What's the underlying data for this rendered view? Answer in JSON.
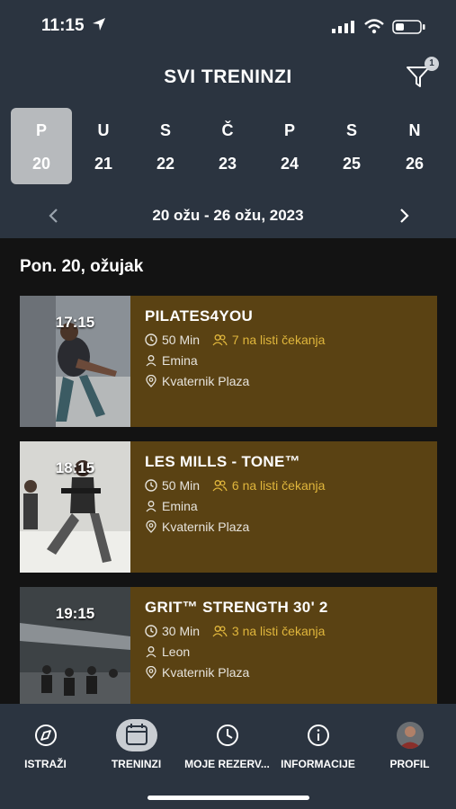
{
  "status": {
    "time": "11:15"
  },
  "header": {
    "title": "SVI TRENINZI",
    "filter_badge": "1"
  },
  "week": {
    "days": [
      {
        "letter": "P",
        "num": "20",
        "selected": true
      },
      {
        "letter": "U",
        "num": "21"
      },
      {
        "letter": "S",
        "num": "22"
      },
      {
        "letter": "Č",
        "num": "23"
      },
      {
        "letter": "P",
        "num": "24"
      },
      {
        "letter": "S",
        "num": "25"
      },
      {
        "letter": "N",
        "num": "26"
      }
    ],
    "range": "20 ožu - 26 ožu, 2023"
  },
  "list": {
    "date_heading": "Pon. 20, ožujak",
    "classes": [
      {
        "time": "17:15",
        "name": "PILATES4YOU",
        "duration": "50 Min",
        "waitlist": "7 na listi čekanja",
        "trainer": "Emina",
        "location": "Kvaternik Plaza"
      },
      {
        "time": "18:15",
        "name": "LES MILLS - TONE™",
        "duration": "50 Min",
        "waitlist": "6 na listi čekanja",
        "trainer": "Emina",
        "location": "Kvaternik Plaza"
      },
      {
        "time": "19:15",
        "name": "GRIT™ STRENGTH 30' 2",
        "duration": "30 Min",
        "waitlist": "3 na listi čekanja",
        "trainer": "Leon",
        "location": "Kvaternik Plaza"
      }
    ]
  },
  "tabs": [
    {
      "label": "ISTRAŽI",
      "icon": "compass-icon"
    },
    {
      "label": "TRENINZI",
      "icon": "calendar-icon",
      "selected": true
    },
    {
      "label": "MOJE REZERV...",
      "icon": "clock-icon"
    },
    {
      "label": "INFORMACIJE",
      "icon": "info-icon"
    },
    {
      "label": "PROFIL",
      "icon": "avatar"
    }
  ]
}
